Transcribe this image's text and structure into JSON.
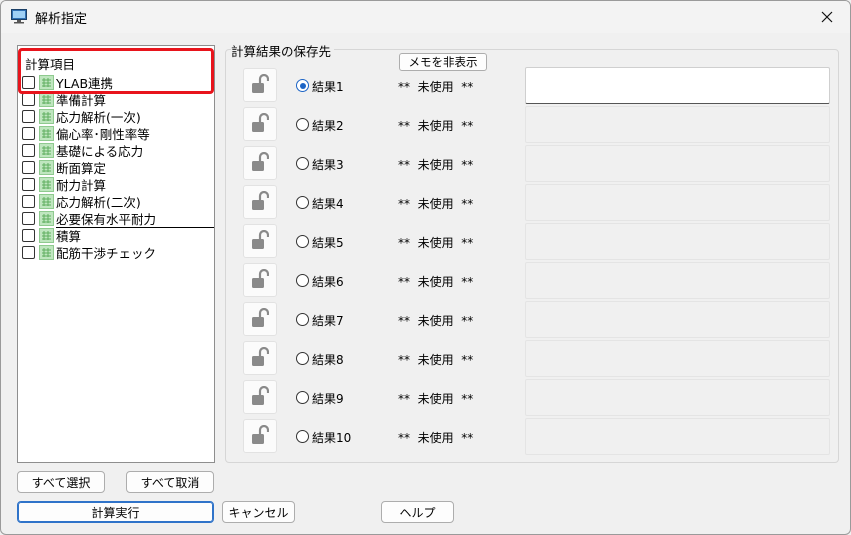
{
  "window": {
    "title": "解析指定"
  },
  "tree": {
    "header": "計算項目",
    "items": [
      {
        "label": "YLAB連携"
      },
      {
        "label": "準備計算"
      },
      {
        "label": "応力解析(一次)"
      },
      {
        "label": "偏心率･剛性率等"
      },
      {
        "label": "基礎による応力"
      },
      {
        "label": "断面算定"
      },
      {
        "label": "耐力計算"
      },
      {
        "label": "応力解析(二次)"
      },
      {
        "label": "必要保有水平耐力"
      },
      {
        "label": "積算"
      },
      {
        "label": "配筋干渉チェック"
      }
    ]
  },
  "buttons": {
    "select_all": "すべて選択",
    "deselect_all": "すべて取消",
    "run": "計算実行",
    "cancel": "キャンセル",
    "help": "ヘルプ"
  },
  "results_group": {
    "label": "計算結果の保存先",
    "memo_toggle": "メモを非表示",
    "rows": [
      {
        "label": "結果1",
        "status": "**  未使用  **",
        "selected": true,
        "memo": ""
      },
      {
        "label": "結果2",
        "status": "**  未使用  **",
        "selected": false,
        "memo": ""
      },
      {
        "label": "結果3",
        "status": "**  未使用  **",
        "selected": false,
        "memo": ""
      },
      {
        "label": "結果4",
        "status": "**  未使用  **",
        "selected": false,
        "memo": ""
      },
      {
        "label": "結果5",
        "status": "**  未使用  **",
        "selected": false,
        "memo": ""
      },
      {
        "label": "結果6",
        "status": "**  未使用  **",
        "selected": false,
        "memo": ""
      },
      {
        "label": "結果7",
        "status": "**  未使用  **",
        "selected": false,
        "memo": ""
      },
      {
        "label": "結果8",
        "status": "**  未使用  **",
        "selected": false,
        "memo": ""
      },
      {
        "label": "結果9",
        "status": "**  未使用  **",
        "selected": false,
        "memo": ""
      },
      {
        "label": "結果10",
        "status": "**  未使用  **",
        "selected": false,
        "memo": ""
      }
    ]
  },
  "colors": {
    "accent": "#1c64c6",
    "highlight": "#e8141c",
    "node_icon": "#bfe6bf"
  }
}
